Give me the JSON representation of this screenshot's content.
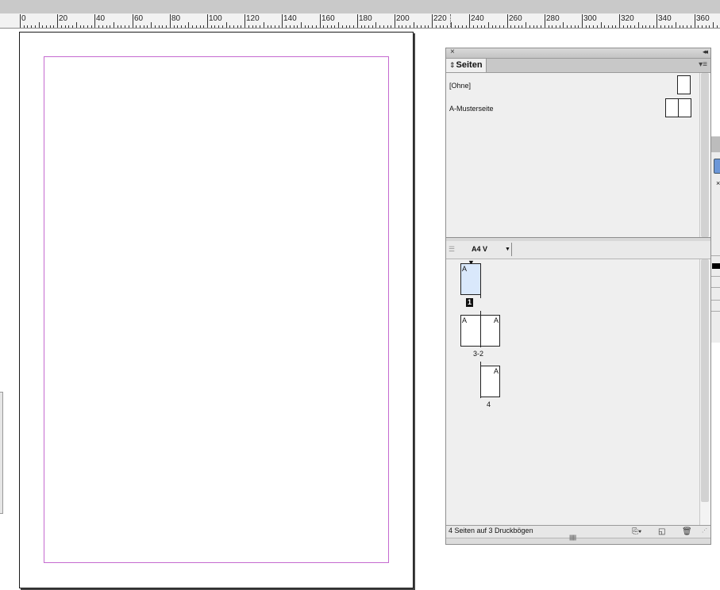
{
  "ruler": {
    "labels": [
      "0",
      "20",
      "40",
      "60",
      "80",
      "100",
      "120",
      "140",
      "160",
      "180",
      "200",
      "220",
      "240",
      "260",
      "280",
      "300",
      "320",
      "340",
      "360"
    ]
  },
  "panel": {
    "close_icon": "close-icon",
    "collapse_icon": "double-chevron-left-icon",
    "tab_label": "Seiten",
    "tab_updown_icon": "updown-arrows-icon",
    "menu_icon": "panel-menu-icon",
    "masters": [
      {
        "label": "[Ohne]"
      },
      {
        "label": "A-Musterseite"
      }
    ],
    "page_size": {
      "value": "A4 V",
      "arrow_icon": "dropdown-arrow-icon"
    },
    "pages": [
      {
        "letter": "A",
        "number": "1",
        "current": true
      },
      {
        "letters": [
          "A",
          "A"
        ],
        "number": "3-2"
      },
      {
        "letter": "A",
        "number": "4"
      }
    ],
    "status_text": "4 Seiten auf 3 Druckbögen",
    "status_icons": [
      "page-size-icon",
      "new-page-icon",
      "trash-icon"
    ]
  },
  "right_panel": {
    "close_glyph": "×"
  },
  "colors": {
    "margin_guide": "#c56ad0",
    "selected_page": "#d9e8fb",
    "accent": "#6c97d8"
  }
}
